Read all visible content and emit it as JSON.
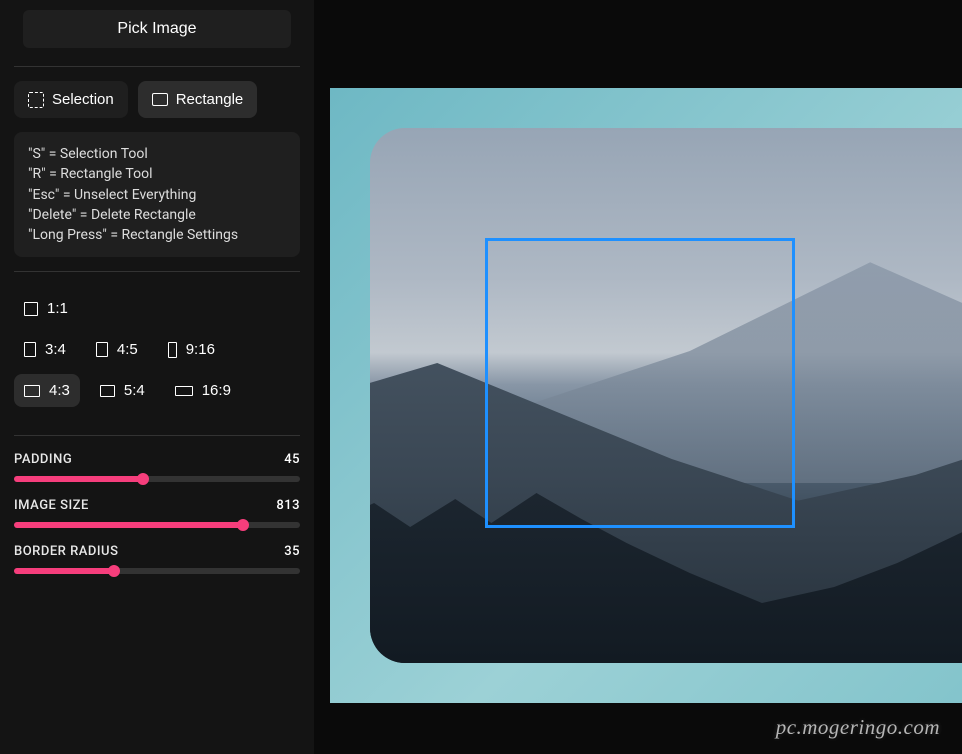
{
  "pick_button": "Pick Image",
  "tools": {
    "selection": "Selection",
    "rectangle": "Rectangle"
  },
  "hints": [
    "\"S\" = Selection Tool",
    "\"R\" = Rectangle Tool",
    "\"Esc\" = Unselect Everything",
    "\"Delete\" = Delete Rectangle",
    "\"Long Press\" = Rectangle Settings"
  ],
  "ratios": {
    "r1_1": "1:1",
    "r3_4": "3:4",
    "r4_5": "4:5",
    "r9_16": "9:16",
    "r4_3": "4:3",
    "r5_4": "5:4",
    "r16_9": "16:9"
  },
  "sliders": {
    "padding": {
      "label": "PADDING",
      "value": "45",
      "percent": 45
    },
    "image_size": {
      "label": "IMAGE SIZE",
      "value": "813",
      "percent": 80
    },
    "border_radius": {
      "label": "BORDER RADIUS",
      "value": "35",
      "percent": 35
    }
  },
  "watermark": "pc.mogeringo.com",
  "colors": {
    "accent": "#f63e7c",
    "selection_border": "#1e90ff",
    "panel_bg": "#141414",
    "frame_gradient_start": "#6eb8c4",
    "frame_gradient_end": "#9cd1d6"
  }
}
